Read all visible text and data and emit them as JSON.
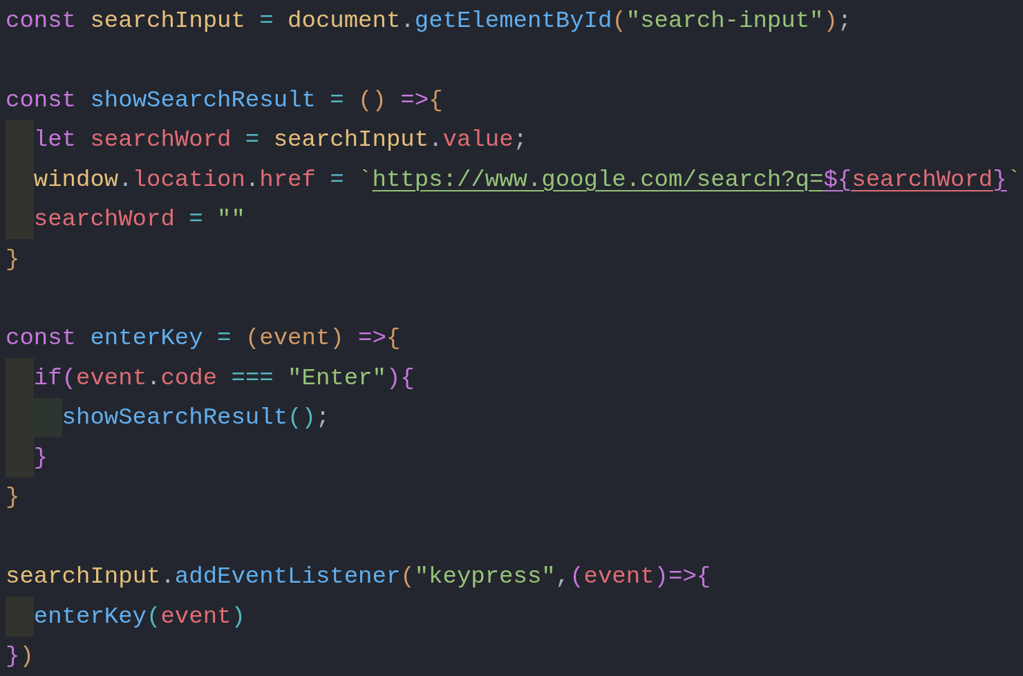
{
  "editor": {
    "lines": [
      {
        "tokens": [
          {
            "text": "const",
            "color": "#c678dd"
          },
          {
            "text": " searchInput",
            "color": "#e5c07b"
          },
          {
            "text": " = ",
            "color": "#56b6c2"
          },
          {
            "text": "document",
            "color": "#e5c07b"
          },
          {
            "text": ".",
            "color": "#abb2bf"
          },
          {
            "text": "getElementById",
            "color": "#61afef"
          },
          {
            "text": "(",
            "color": "#d19a66"
          },
          {
            "text": "\"search-input\"",
            "color": "#98c379"
          },
          {
            "text": ")",
            "color": "#d19a66"
          },
          {
            "text": ";",
            "color": "#abb2bf"
          }
        ]
      },
      {
        "blank_line_before": true,
        "tokens": [
          {
            "text": "const",
            "color": "#c678dd"
          },
          {
            "text": " showSearchResult",
            "color": "#61afef"
          },
          {
            "text": " = ",
            "color": "#56b6c2"
          },
          {
            "text": "()",
            "color": "#d19a66"
          },
          {
            "text": " =>",
            "color": "#c678dd"
          },
          {
            "text": "{",
            "color": "#d19a66"
          }
        ]
      },
      {
        "guides": [
          {
            "color": "#32332d"
          }
        ],
        "tokens": [
          {
            "text": "let",
            "color": "#c678dd"
          },
          {
            "text": " searchWord",
            "color": "#e06c75"
          },
          {
            "text": " = ",
            "color": "#56b6c2"
          },
          {
            "text": "searchInput",
            "color": "#e5c07b"
          },
          {
            "text": ".",
            "color": "#abb2bf"
          },
          {
            "text": "value",
            "color": "#e06c75"
          },
          {
            "text": ";",
            "color": "#abb2bf"
          }
        ]
      },
      {
        "guides": [
          {
            "color": "#32332d"
          }
        ],
        "tokens": [
          {
            "text": "window",
            "color": "#e5c07b"
          },
          {
            "text": ".",
            "color": "#abb2bf"
          },
          {
            "text": "location",
            "color": "#e06c75"
          },
          {
            "text": ".",
            "color": "#abb2bf"
          },
          {
            "text": "href",
            "color": "#e06c75"
          },
          {
            "text": " = ",
            "color": "#56b6c2"
          },
          {
            "text": "`",
            "color": "#98c379"
          },
          {
            "text": "https://www.google.com/search?q=",
            "color": "#98c379",
            "underlined": true
          },
          {
            "text": "${",
            "color": "#c678dd",
            "underlined": true
          },
          {
            "text": "searchWord",
            "color": "#e06c75",
            "underlined": true
          },
          {
            "text": "}",
            "color": "#c678dd",
            "underlined": true
          },
          {
            "text": "`",
            "color": "#98c379"
          }
        ]
      },
      {
        "guides": [
          {
            "color": "#32332d"
          }
        ],
        "tokens": [
          {
            "text": "searchWord",
            "color": "#e06c75"
          },
          {
            "text": " = ",
            "color": "#56b6c2"
          },
          {
            "text": "\"\"",
            "color": "#98c379"
          }
        ]
      },
      {
        "tokens": [
          {
            "text": "}",
            "color": "#d19a66"
          }
        ]
      },
      {
        "blank_line_before": true,
        "tokens": [
          {
            "text": "const",
            "color": "#c678dd"
          },
          {
            "text": " enterKey",
            "color": "#61afef"
          },
          {
            "text": " = ",
            "color": "#56b6c2"
          },
          {
            "text": "(event)",
            "color": "#d19a66"
          },
          {
            "text": " =>",
            "color": "#c678dd"
          },
          {
            "text": "{",
            "color": "#d19a66"
          }
        ]
      },
      {
        "guides": [
          {
            "color": "#32332d"
          }
        ],
        "tokens": [
          {
            "text": "if",
            "color": "#c678dd"
          },
          {
            "text": "(",
            "color": "#c678dd"
          },
          {
            "text": "event",
            "color": "#e06c75"
          },
          {
            "text": ".",
            "color": "#abb2bf"
          },
          {
            "text": "code",
            "color": "#e06c75"
          },
          {
            "text": " === ",
            "color": "#56b6c2"
          },
          {
            "text": "\"Enter\"",
            "color": "#98c379"
          },
          {
            "text": "){",
            "color": "#c678dd"
          }
        ]
      },
      {
        "guides": [
          {
            "color": "#32332d"
          },
          {
            "color": "#2c3530"
          }
        ],
        "tokens": [
          {
            "text": "showSearchResult",
            "color": "#61afef"
          },
          {
            "text": "()",
            "color": "#56b6c2"
          },
          {
            "text": ";",
            "color": "#abb2bf"
          }
        ]
      },
      {
        "guides": [
          {
            "color": "#32332d"
          }
        ],
        "tokens": [
          {
            "text": "}",
            "color": "#c678dd"
          }
        ]
      },
      {
        "tokens": [
          {
            "text": "}",
            "color": "#d19a66"
          }
        ]
      },
      {
        "blank_line_before": true,
        "tokens": [
          {
            "text": "searchInput",
            "color": "#e5c07b"
          },
          {
            "text": ".",
            "color": "#abb2bf"
          },
          {
            "text": "addEventListener",
            "color": "#61afef"
          },
          {
            "text": "(",
            "color": "#d19a66"
          },
          {
            "text": "\"keypress\"",
            "color": "#98c379"
          },
          {
            "text": ",",
            "color": "#abb2bf"
          },
          {
            "text": "(",
            "color": "#c678dd"
          },
          {
            "text": "event",
            "color": "#e06c75"
          },
          {
            "text": ")=>{",
            "color": "#c678dd"
          }
        ]
      },
      {
        "guides": [
          {
            "color": "#32332d"
          }
        ],
        "tokens": [
          {
            "text": "enterKey",
            "color": "#61afef"
          },
          {
            "text": "(",
            "color": "#56b6c2"
          },
          {
            "text": "event",
            "color": "#e06c75"
          },
          {
            "text": ")",
            "color": "#56b6c2"
          }
        ]
      },
      {
        "tokens": [
          {
            "text": "}",
            "color": "#c678dd"
          },
          {
            "text": ")",
            "color": "#d19a66"
          }
        ]
      }
    ]
  }
}
